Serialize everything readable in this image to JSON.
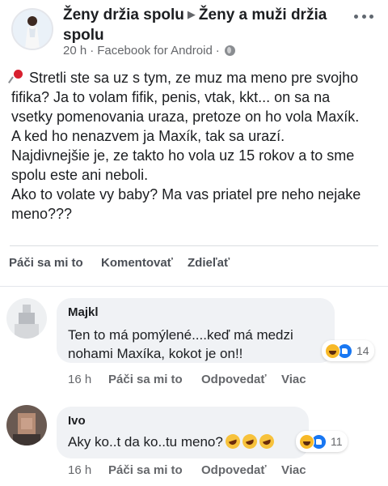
{
  "post": {
    "page_name": "Ženy držia spolu",
    "separator": "▶",
    "group_name": "Ženy a muži držia spolu",
    "time": "20 h",
    "dot": "·",
    "source": "Facebook for Android",
    "body_lines": [
      "Stretli ste sa uz s tym, ze muz ma meno pre svojho",
      "fifika? Ja to volam fifik, penis, vtak, kkt... on sa na",
      "vsetky pomenovania uraza, pretoze on ho vola Maxík.",
      "A ked ho nenazvem ja Maxík, tak sa urazí.",
      "Najdivnejšie je, ze takto ho vola uz 15 rokov a to sme",
      "spolu este ani neboli.",
      "Ako to volate vy baby? Ma vas priatel pre neho nejake",
      "meno???"
    ]
  },
  "actions": {
    "like": "Páči sa mi to",
    "comment": "Komentovať",
    "share": "Zdieľať"
  },
  "comments": [
    {
      "author": "Majkl",
      "text_lines": [
        "Ten to má pomýlené....keď má medzi",
        "nohami Maxíka, kokot je on!!"
      ],
      "reaction_count": "14",
      "time": "16 h",
      "like": "Páči sa mi to",
      "reply": "Odpovedať",
      "more": "Viac"
    },
    {
      "author": "Ivo",
      "text": "Aky ko..t da ko..tu meno?",
      "reaction_count": "11",
      "time": "16 h",
      "like": "Páči sa mi to",
      "reply": "Odpovedať",
      "more": "Viac"
    }
  ],
  "icons": {
    "page_avatar": "page-avatar-photo",
    "globe": "globe-icon",
    "more": "more-options-icon",
    "pin": "pushpin-icon",
    "haha": "haha-reaction-icon",
    "like": "like-reaction-icon",
    "rofl": "rofl-emoji-icon"
  },
  "colors": {
    "bubble": "#f0f2f5",
    "meta_text": "#65676b",
    "like_blue": "#1877f2",
    "haha_yellow": "#f7b928"
  }
}
